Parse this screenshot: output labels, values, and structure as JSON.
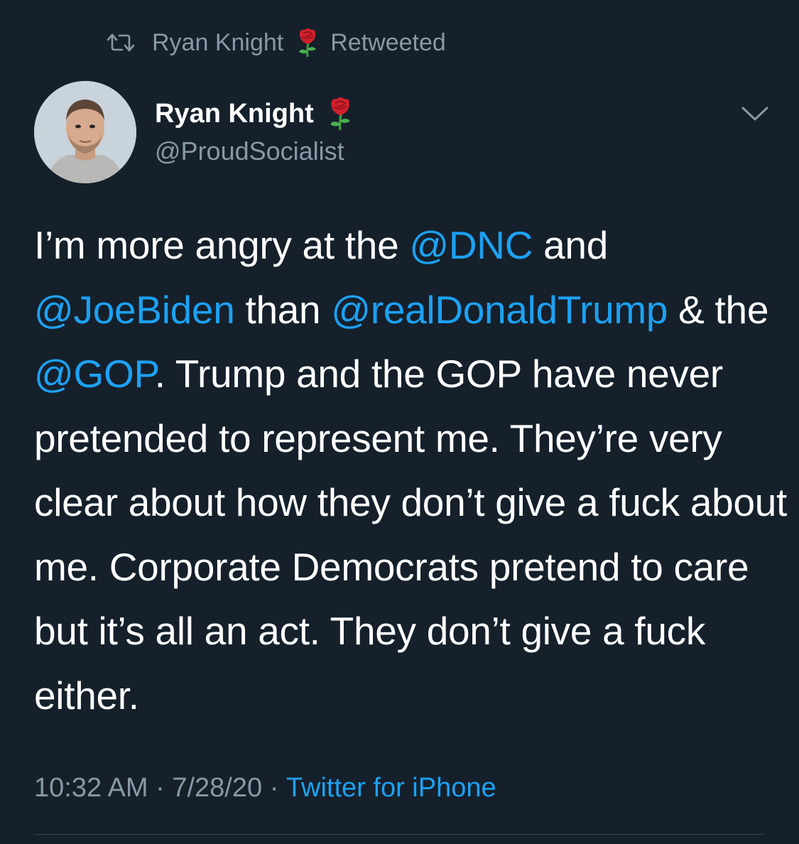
{
  "retweet": {
    "name": "Ryan Knight",
    "label": "Retweeted",
    "icon": "retweet-icon",
    "emoji_icon": "rose-icon"
  },
  "author": {
    "display_name": "Ryan Knight",
    "handle": "@ProudSocialist",
    "emoji_icon": "rose-icon",
    "avatar_icon": "avatar-photo"
  },
  "menu": {
    "icon": "chevron-down-icon"
  },
  "tweet": {
    "segments": [
      {
        "text": "I’m more angry at the ",
        "mention": false
      },
      {
        "text": "@DNC",
        "mention": true
      },
      {
        "text": " and ",
        "mention": false
      },
      {
        "text": "@JoeBiden",
        "mention": true
      },
      {
        "text": " than ",
        "mention": false
      },
      {
        "text": "@realDonaldTrump",
        "mention": true
      },
      {
        "text": " & the ",
        "mention": false
      },
      {
        "text": "@GOP",
        "mention": true
      },
      {
        "text": ". Trump and the GOP have never pretended to represent me. They’re very clear about how they don’t give a fuck about me. Corporate Democrats pretend to care but it’s all an act. They don’t give a fuck either.",
        "mention": false
      }
    ]
  },
  "meta": {
    "time": "10:32 AM",
    "separator": " · ",
    "date": "7/28/20",
    "source": "Twitter for iPhone"
  },
  "colors": {
    "background": "#15202b",
    "text": "#ffffff",
    "muted": "#8899a6",
    "link": "#1da1f2",
    "rose": "#d0212b"
  }
}
